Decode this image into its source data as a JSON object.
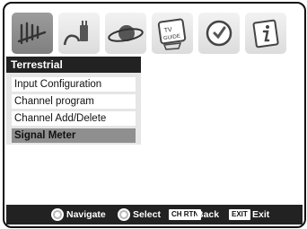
{
  "tabs": [
    {
      "icon": "antenna-icon",
      "selected": true
    },
    {
      "icon": "plug-icon",
      "selected": false
    },
    {
      "icon": "planet-icon",
      "selected": false
    },
    {
      "icon": "tv-guide-icon",
      "label": "TV GUIDE",
      "selected": false
    },
    {
      "icon": "clock-icon",
      "selected": false
    },
    {
      "icon": "info-icon",
      "selected": false
    }
  ],
  "menu": {
    "title": "Terrestrial",
    "items": [
      {
        "label": "Input Configuration",
        "selected": false
      },
      {
        "label": "Channel program",
        "selected": false
      },
      {
        "label": "Channel Add/Delete",
        "selected": false
      },
      {
        "label": "Signal Meter",
        "selected": true
      }
    ]
  },
  "footer": {
    "navigate": "Navigate",
    "select": "Select",
    "back_key": "CH RTN",
    "back": "Back",
    "exit_key": "EXIT",
    "exit": "Exit"
  }
}
